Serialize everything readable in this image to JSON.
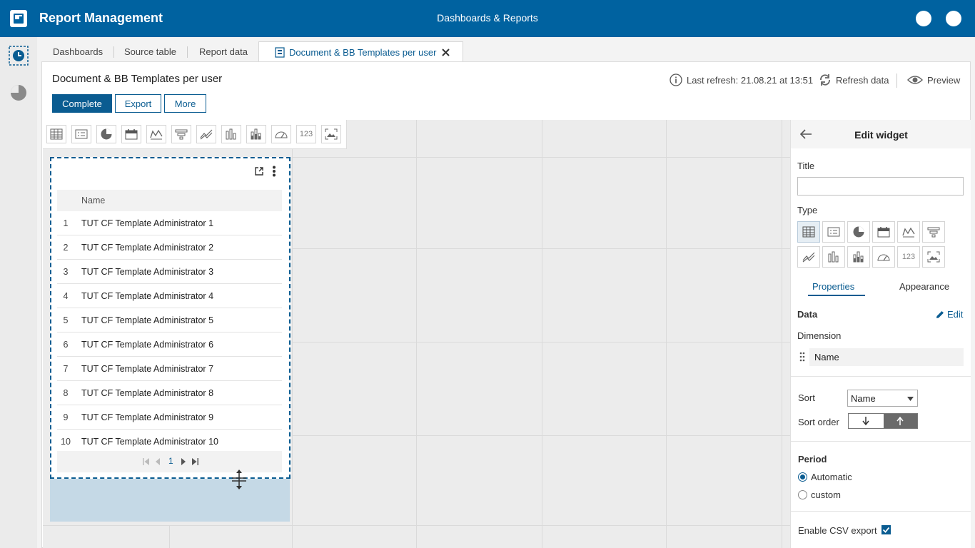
{
  "app": {
    "title": "Report Management",
    "center_title": "Dashboards & Reports"
  },
  "tabs": [
    {
      "label": "Dashboards"
    },
    {
      "label": "Source table"
    },
    {
      "label": "Report data"
    },
    {
      "label": "Document & BB Templates per user"
    }
  ],
  "page": {
    "title": "Document & BB Templates per user",
    "last_refresh": "Last refresh: 21.08.21 at 13:51",
    "refresh_label": "Refresh data",
    "preview_label": "Preview",
    "buttons": {
      "complete": "Complete",
      "export": "Export",
      "more": "More"
    }
  },
  "widget_toolbar": {
    "number_label": "123"
  },
  "table": {
    "header": "Name",
    "rows": [
      {
        "num": "1",
        "name": "TUT CF Template Administrator 1"
      },
      {
        "num": "2",
        "name": "TUT CF Template Administrator 2"
      },
      {
        "num": "3",
        "name": "TUT CF Template Administrator 3"
      },
      {
        "num": "4",
        "name": "TUT CF Template Administrator 4"
      },
      {
        "num": "5",
        "name": "TUT CF Template Administrator 5"
      },
      {
        "num": "6",
        "name": "TUT CF Template Administrator 6"
      },
      {
        "num": "7",
        "name": "TUT CF Template Administrator 7"
      },
      {
        "num": "8",
        "name": "TUT CF Template Administrator 8"
      },
      {
        "num": "9",
        "name": "TUT CF Template Administrator 9"
      },
      {
        "num": "10",
        "name": "TUT CF Template Administrator 10"
      }
    ],
    "page": "1"
  },
  "sidebar": {
    "header": "Edit widget",
    "title_label": "Title",
    "title_value": "",
    "type_label": "Type",
    "number_label": "123",
    "tabs": {
      "properties": "Properties",
      "appearance": "Appearance"
    },
    "data_label": "Data",
    "edit_label": "Edit",
    "dimension_label": "Dimension",
    "dimension_value": "Name",
    "sort_label": "Sort",
    "sort_value": "Name",
    "sort_order_label": "Sort order",
    "period_label": "Period",
    "period_automatic": "Automatic",
    "period_custom": "custom",
    "csv_label": "Enable CSV export"
  },
  "colors": {
    "brand": "#0062a0",
    "accent": "#0a5c91"
  }
}
